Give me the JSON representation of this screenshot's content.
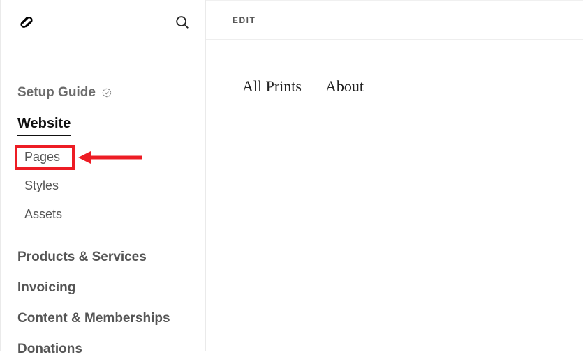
{
  "sidebar": {
    "setup_guide_label": "Setup Guide",
    "website_label": "Website",
    "subitems": [
      {
        "label": "Pages"
      },
      {
        "label": "Styles"
      },
      {
        "label": "Assets"
      }
    ],
    "products_label": "Products & Services",
    "invoicing_label": "Invoicing",
    "content_label": "Content & Memberships",
    "donations_label": "Donations"
  },
  "main": {
    "edit_label": "EDIT",
    "preview_nav": [
      {
        "label": "All Prints"
      },
      {
        "label": "About"
      }
    ]
  },
  "annotation": {
    "highlight_target": "Pages",
    "color": "#ed1c24"
  }
}
